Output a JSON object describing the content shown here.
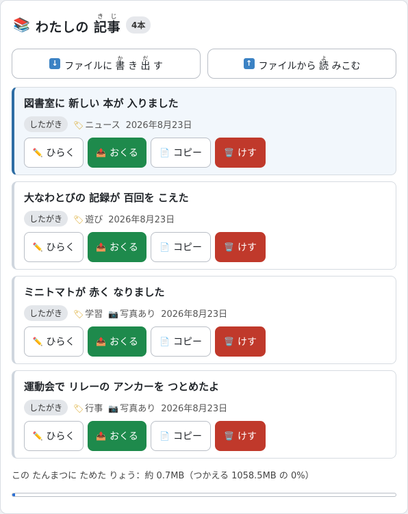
{
  "header": {
    "icon": "books-icon",
    "title_pre": "わたしの ",
    "title_ruby_base": "記事",
    "title_ruby_reading": "きじ",
    "count": "4本"
  },
  "io": {
    "export_icon": "arrow-down-icon",
    "export_pre": "ファイルに ",
    "export_ruby1_base": "書",
    "export_ruby1_reading": "か",
    "export_mid": "き ",
    "export_ruby2_base": "出",
    "export_ruby2_reading": "だ",
    "export_post": " す",
    "import_icon": "arrow-up-icon",
    "import_pre": "ファイルから ",
    "import_ruby_base": "読",
    "import_ruby_reading": "よ",
    "import_post": " みこむ"
  },
  "buttons": {
    "open": "ひらく",
    "send": "おくる",
    "copy": "コピー",
    "delete": "けす"
  },
  "articles": [
    {
      "title": "図書室に 新しい 本が 入りました",
      "status": "したがき",
      "tag": "ニュース",
      "photo": "",
      "date": "2026年8月23日",
      "active": true
    },
    {
      "title": "大なわとびの 記録が 百回を こえた",
      "status": "したがき",
      "tag": "遊び",
      "photo": "",
      "date": "2026年8月23日",
      "active": false
    },
    {
      "title": "ミニトマトが 赤く なりました",
      "status": "したがき",
      "tag": "学習",
      "photo": "写真あり",
      "date": "2026年8月23日",
      "active": false
    },
    {
      "title": "運動会で リレーの アンカーを つとめたよ",
      "status": "したがき",
      "tag": "行事",
      "photo": "写真あり",
      "date": "2026年8月23日",
      "active": false
    }
  ],
  "storage": {
    "text": "この たんまつに ためた りょう：約 0.7MB（つかえる 1058.5MB の 0%）",
    "fraction": 0.0066
  },
  "colors": {
    "send": "#1e8a4c",
    "delete": "#c0392b",
    "active_border": "#2e6da4",
    "progress": "#2a6fd6"
  }
}
